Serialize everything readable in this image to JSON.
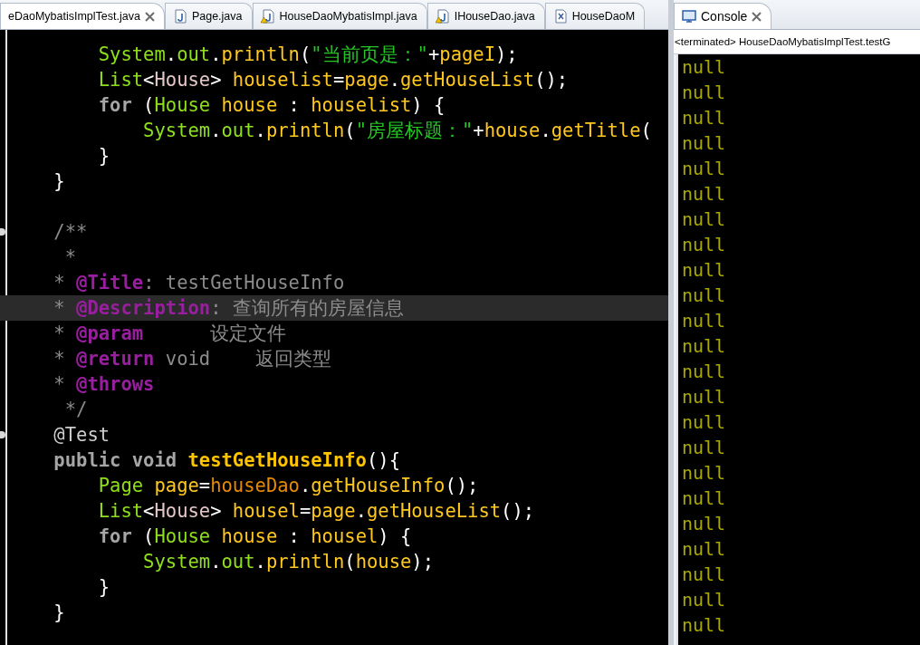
{
  "editor": {
    "tabs": [
      {
        "label": "eDaoMybatisImplTest.java",
        "kind": "plain",
        "selected": true
      },
      {
        "label": "Page.java",
        "kind": "java",
        "selected": false
      },
      {
        "label": "HouseDaoMybatisImpl.java",
        "kind": "warning",
        "selected": false
      },
      {
        "label": "IHouseDao.java",
        "kind": "warning",
        "selected": false
      },
      {
        "label": "HouseDaoM",
        "kind": "xml",
        "selected": false
      }
    ],
    "lines": [
      {
        "current": false,
        "fold": false,
        "tokens": [
          {
            "t": "        System",
            "kind": "type"
          },
          {
            "t": ".",
            "kind": "plain"
          },
          {
            "t": "out",
            "kind": "type"
          },
          {
            "t": ".",
            "kind": "plain"
          },
          {
            "t": "println",
            "kind": "method"
          },
          {
            "t": "(",
            "kind": "plain"
          },
          {
            "t": "\"当前页是：\"",
            "kind": "string"
          },
          {
            "t": "+",
            "kind": "plain"
          },
          {
            "t": "pageI",
            "kind": "var"
          },
          {
            "t": ");",
            "kind": "plain"
          }
        ]
      },
      {
        "current": false,
        "fold": false,
        "tokens": [
          {
            "t": "        List",
            "kind": "type"
          },
          {
            "t": "<",
            "kind": "plain"
          },
          {
            "t": "House",
            "kind": "generic"
          },
          {
            "t": "> ",
            "kind": "plain"
          },
          {
            "t": "houselist",
            "kind": "var"
          },
          {
            "t": "=",
            "kind": "plain"
          },
          {
            "t": "page",
            "kind": "var"
          },
          {
            "t": ".",
            "kind": "plain"
          },
          {
            "t": "getHouseList",
            "kind": "method"
          },
          {
            "t": "();",
            "kind": "plain"
          }
        ]
      },
      {
        "current": false,
        "fold": false,
        "tokens": [
          {
            "t": "        for ",
            "kind": "keyword"
          },
          {
            "t": "(",
            "kind": "plain"
          },
          {
            "t": "House ",
            "kind": "type"
          },
          {
            "t": "house",
            "kind": "var"
          },
          {
            "t": " : ",
            "kind": "plain"
          },
          {
            "t": "houselist",
            "kind": "var"
          },
          {
            "t": ") {",
            "kind": "plain"
          }
        ]
      },
      {
        "current": false,
        "fold": false,
        "tokens": [
          {
            "t": "            System",
            "kind": "type"
          },
          {
            "t": ".",
            "kind": "plain"
          },
          {
            "t": "out",
            "kind": "type"
          },
          {
            "t": ".",
            "kind": "plain"
          },
          {
            "t": "println",
            "kind": "method"
          },
          {
            "t": "(",
            "kind": "plain"
          },
          {
            "t": "\"房屋标题：\"",
            "kind": "string"
          },
          {
            "t": "+",
            "kind": "plain"
          },
          {
            "t": "house",
            "kind": "var"
          },
          {
            "t": ".",
            "kind": "plain"
          },
          {
            "t": "getTitle",
            "kind": "method"
          },
          {
            "t": "(",
            "kind": "plain"
          }
        ]
      },
      {
        "current": false,
        "fold": false,
        "tokens": [
          {
            "t": "        }",
            "kind": "plain"
          }
        ]
      },
      {
        "current": false,
        "fold": false,
        "tokens": [
          {
            "t": "    }",
            "kind": "plain"
          }
        ]
      },
      {
        "current": false,
        "fold": false
      },
      {
        "current": false,
        "fold": true,
        "tokens": [
          {
            "t": "    /**",
            "kind": "comment"
          }
        ]
      },
      {
        "current": false,
        "fold": false,
        "tokens": [
          {
            "t": "     *",
            "kind": "comment"
          }
        ]
      },
      {
        "current": false,
        "fold": false,
        "tokens": [
          {
            "t": "    * ",
            "kind": "comment"
          },
          {
            "t": "@Title",
            "kind": "tag"
          },
          {
            "t": ": testGetHouseInfo",
            "kind": "comment"
          }
        ]
      },
      {
        "current": true,
        "fold": false,
        "tokens": [
          {
            "t": "    * ",
            "kind": "comment"
          },
          {
            "t": "@Description",
            "kind": "tag"
          },
          {
            "t": ": 查询所有的房屋信息",
            "kind": "comment"
          }
        ]
      },
      {
        "current": false,
        "fold": false,
        "tokens": [
          {
            "t": "    * ",
            "kind": "comment"
          },
          {
            "t": "@param",
            "kind": "tag"
          },
          {
            "t": "      设定文件",
            "kind": "comment"
          }
        ]
      },
      {
        "current": false,
        "fold": false,
        "tokens": [
          {
            "t": "    * ",
            "kind": "comment"
          },
          {
            "t": "@return",
            "kind": "tag"
          },
          {
            "t": " void    返回类型",
            "kind": "comment"
          }
        ]
      },
      {
        "current": false,
        "fold": false,
        "tokens": [
          {
            "t": "    * ",
            "kind": "comment"
          },
          {
            "t": "@throws",
            "kind": "tag"
          }
        ]
      },
      {
        "current": false,
        "fold": false,
        "tokens": [
          {
            "t": "     */",
            "kind": "comment"
          }
        ]
      },
      {
        "current": false,
        "fold": true,
        "tokens": [
          {
            "t": "    @Test",
            "kind": "annotation"
          }
        ]
      },
      {
        "current": false,
        "fold": false,
        "tokens": [
          {
            "t": "    public void ",
            "kind": "keyword"
          },
          {
            "t": "testGetHouseInfo",
            "kind": "decl"
          },
          {
            "t": "(){",
            "kind": "plain"
          }
        ]
      },
      {
        "current": false,
        "fold": false,
        "tokens": [
          {
            "t": "        Page ",
            "kind": "type"
          },
          {
            "t": "page",
            "kind": "var"
          },
          {
            "t": "=",
            "kind": "plain"
          },
          {
            "t": "houseDao",
            "kind": "member"
          },
          {
            "t": ".",
            "kind": "plain"
          },
          {
            "t": "getHouseInfo",
            "kind": "method"
          },
          {
            "t": "();",
            "kind": "plain"
          }
        ]
      },
      {
        "current": false,
        "fold": false,
        "tokens": [
          {
            "t": "        List",
            "kind": "type"
          },
          {
            "t": "<",
            "kind": "plain"
          },
          {
            "t": "House",
            "kind": "generic"
          },
          {
            "t": "> ",
            "kind": "plain"
          },
          {
            "t": "housel",
            "kind": "var"
          },
          {
            "t": "=",
            "kind": "plain"
          },
          {
            "t": "page",
            "kind": "var"
          },
          {
            "t": ".",
            "kind": "plain"
          },
          {
            "t": "getHouseList",
            "kind": "method"
          },
          {
            "t": "();",
            "kind": "plain"
          }
        ]
      },
      {
        "current": false,
        "fold": false,
        "tokens": [
          {
            "t": "        for ",
            "kind": "keyword"
          },
          {
            "t": "(",
            "kind": "plain"
          },
          {
            "t": "House ",
            "kind": "type"
          },
          {
            "t": "house",
            "kind": "var"
          },
          {
            "t": " : ",
            "kind": "plain"
          },
          {
            "t": "housel",
            "kind": "var"
          },
          {
            "t": ") {",
            "kind": "plain"
          }
        ]
      },
      {
        "current": false,
        "fold": false,
        "tokens": [
          {
            "t": "            System",
            "kind": "type"
          },
          {
            "t": ".",
            "kind": "plain"
          },
          {
            "t": "out",
            "kind": "type"
          },
          {
            "t": ".",
            "kind": "plain"
          },
          {
            "t": "println",
            "kind": "method"
          },
          {
            "t": "(",
            "kind": "plain"
          },
          {
            "t": "house",
            "kind": "var"
          },
          {
            "t": ");",
            "kind": "plain"
          }
        ]
      },
      {
        "current": false,
        "fold": false,
        "tokens": [
          {
            "t": "        }",
            "kind": "plain"
          }
        ]
      },
      {
        "current": false,
        "fold": false,
        "tokens": [
          {
            "t": "    }",
            "kind": "plain"
          }
        ]
      }
    ]
  },
  "console": {
    "tab": {
      "label": "Console",
      "selected": true
    },
    "status": "<terminated> HouseDaoMybatisImplTest.testG",
    "output": [
      "null",
      "null",
      "null",
      "null",
      "null",
      "null",
      "null",
      "null",
      "null",
      "null",
      "null",
      "null",
      "null",
      "null",
      "null",
      "null",
      "null",
      "null",
      "null",
      "null",
      "null",
      "null",
      "null"
    ]
  }
}
